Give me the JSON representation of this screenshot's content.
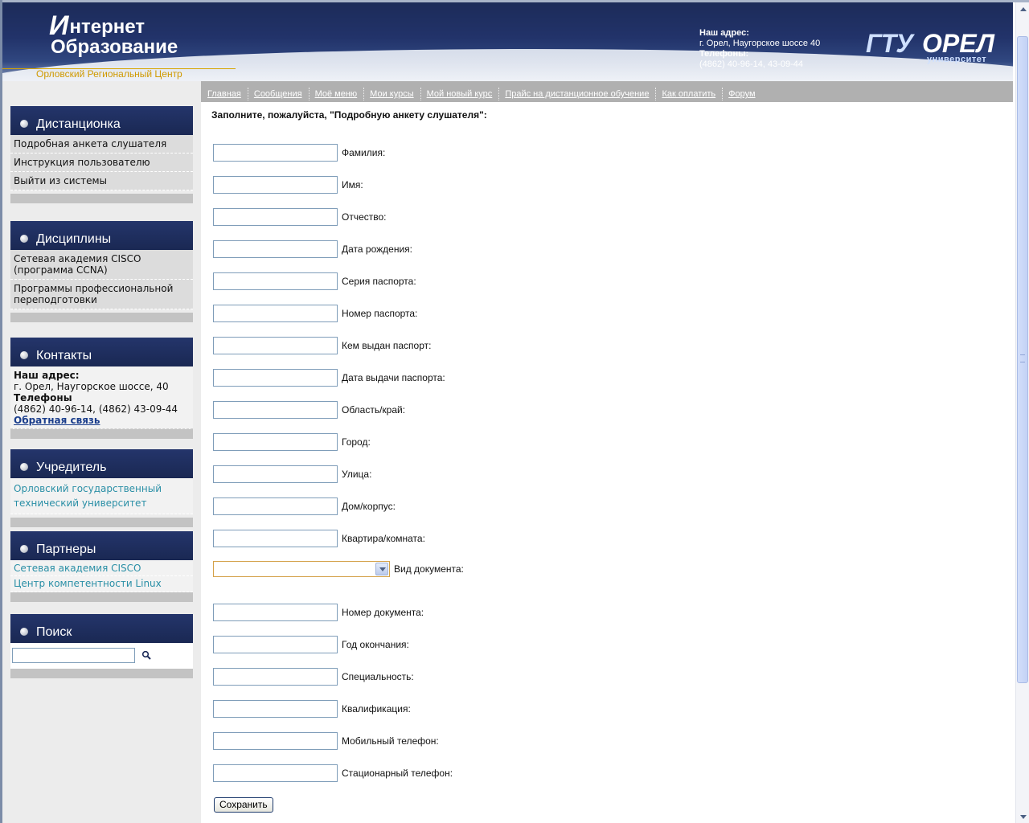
{
  "header": {
    "logo_line1": "нтернет",
    "logo_letter": "И",
    "logo_line2": "Образование",
    "logo_sub": "Орловский Региональный Центр",
    "address_title": "Наш адрес:",
    "address_value": "г. Орел, Наугорское шоссе 40",
    "phones_title": "Телефоны:",
    "phones_value": "(4862) 40-96-14, 43-09-44",
    "univ_left": "ГТУ",
    "univ_right": "ОРЕЛ",
    "univ_sub": "университет"
  },
  "nav": {
    "items": [
      "Главная",
      "Сообщения",
      "Моё меню",
      "Мои курсы",
      "Мой новый курс",
      "Прайс на дистанционное обучение",
      "Как оплатить",
      "Форум"
    ]
  },
  "sidebar": {
    "distance": {
      "title": "Дистанционка",
      "items": [
        "Подробная анкета слушателя",
        "Инструкция пользователю",
        "Выйти из системы"
      ]
    },
    "disciplines": {
      "title": "Дисциплины",
      "items": [
        "Сетевая академия CISCO (программа CCNA)",
        "Программы профессиональной переподготовки"
      ]
    },
    "contacts": {
      "title": "Контакты",
      "address_label": "Наш адрес:",
      "address": "г. Орел, Наугорское шоссе, 40",
      "phones_label": "Телефоны",
      "phones": "(4862) 40-96-14, (4862) 43-09-44",
      "feedback": "Обратная связь"
    },
    "founder": {
      "title": "Учредитель",
      "items": [
        "Орловский государственный технический университет"
      ]
    },
    "partners": {
      "title": "Партнеры",
      "items": [
        "Сетевая академия CISCO",
        "Центр компетентности Linux"
      ]
    },
    "search": {
      "title": "Поиск",
      "icon": "magnifier-icon"
    }
  },
  "form": {
    "heading": "Заполните, пожалуйста, \"Подробную анкету слушателя\":",
    "fields": [
      "Фамилия:",
      "Имя:",
      "Отчество:",
      "Дата рождения:",
      "Серия паспорта:",
      "Номер паспорта:",
      "Кем выдан паспорт:",
      "Дата выдачи паспорта:",
      "Область/край:",
      "Город:",
      "Улица:",
      "Дом/корпус:",
      "Квартира/комната:"
    ],
    "doc_type_label": "Вид документа:",
    "fields2": [
      "Номер документа:",
      "Год окончания:",
      "Специальность:",
      "Квалификация:",
      "Мобильный телефон:",
      "Стационарный телефон:"
    ],
    "save_label": "Сохранить"
  },
  "colors": {
    "header_dark": "#1c2b59",
    "sidebar_head": "#1c2a58",
    "sidebar_bg": "#ececec",
    "nav_bg": "#b0b0b0",
    "logo_gold": "#d09a00",
    "link_teal": "#2a8fa6"
  }
}
